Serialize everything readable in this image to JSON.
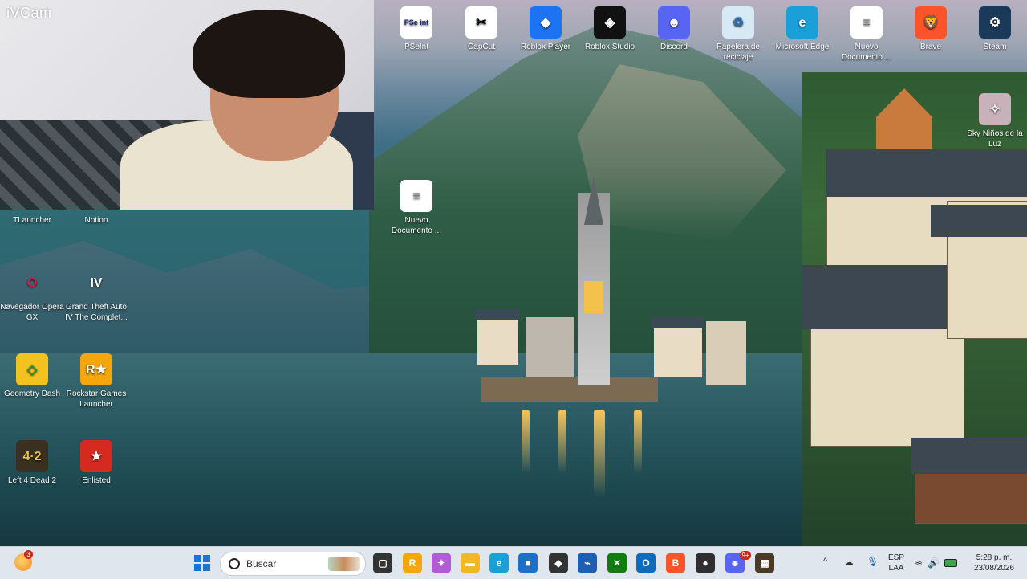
{
  "webcam": {
    "label": "iVCam"
  },
  "desktop_icons": [
    {
      "id": "pseint",
      "label": "PSeInt",
      "glyph": "PSe int",
      "color": "#ffffff",
      "fg": "#1a2a7a"
    },
    {
      "id": "capcut",
      "label": "CapCut",
      "glyph": "✂",
      "color": "#ffffff",
      "fg": "#000000"
    },
    {
      "id": "roblox-player",
      "label": "Roblox Player",
      "glyph": "◆",
      "color": "#1d73f2",
      "fg": "#ffffff"
    },
    {
      "id": "roblox-studio",
      "label": "Roblox Studio",
      "glyph": "◈",
      "color": "#111111",
      "fg": "#ffffff"
    },
    {
      "id": "discord",
      "label": "Discord",
      "glyph": "☻",
      "color": "#5865f2",
      "fg": "#ffffff"
    },
    {
      "id": "recycle-bin",
      "label": "Papelera de reciclaje",
      "glyph": "♻",
      "color": "#d7e9f5",
      "fg": "#2b6fb1"
    },
    {
      "id": "edge",
      "label": "Microsoft Edge",
      "glyph": "e",
      "color": "#1a9fd6",
      "fg": "#ffffff"
    },
    {
      "id": "nuevo-doc-top",
      "label": "Nuevo Documento ...",
      "glyph": "≡",
      "color": "#ffffff",
      "fg": "#7a7a7a"
    },
    {
      "id": "brave",
      "label": "Brave",
      "glyph": "🦁",
      "color": "#fb542b",
      "fg": "#ffffff"
    },
    {
      "id": "steam",
      "label": "Steam",
      "glyph": "⚙",
      "color": "#1b3a5a",
      "fg": "#ffffff"
    },
    {
      "id": "sky",
      "label": "Sky Niños de la Luz",
      "glyph": "✧",
      "color": "#c9b1b9",
      "fg": "#ffffff"
    },
    {
      "id": "tlauncher",
      "label": "TLauncher",
      "glyph": "",
      "color": "transparent",
      "fg": "#ffffff"
    },
    {
      "id": "notion",
      "label": "Notion",
      "glyph": "",
      "color": "transparent",
      "fg": "#ffffff"
    },
    {
      "id": "nuevo-doc-mid",
      "label": "Nuevo Documento ...",
      "glyph": "≡",
      "color": "#ffffff",
      "fg": "#7a7a7a"
    },
    {
      "id": "opera-gx",
      "label": "Navegador Opera GX",
      "glyph": "O",
      "color": "transparent",
      "fg": "#e0164f"
    },
    {
      "id": "gta4",
      "label": "Grand Theft Auto IV The Complet...",
      "glyph": "IV",
      "color": "transparent",
      "fg": "#ffffff"
    },
    {
      "id": "geometry-dash",
      "label": "Geometry Dash",
      "glyph": "◇",
      "color": "#f4c21f",
      "fg": "#1e9c3a"
    },
    {
      "id": "rockstar",
      "label": "Rockstar Games Launcher",
      "glyph": "R★",
      "color": "#f4a60c",
      "fg": "#ffffff"
    },
    {
      "id": "l4d2",
      "label": "Left 4 Dead 2",
      "glyph": "4·2",
      "color": "#3a3020",
      "fg": "#e8c24a"
    },
    {
      "id": "enlisted",
      "label": "Enlisted",
      "glyph": "★",
      "color": "#d42a1f",
      "fg": "#ffffff"
    }
  ],
  "taskbar": {
    "notification_badge": "3",
    "search_placeholder": "Buscar",
    "pinned": [
      {
        "id": "start",
        "glyph": "⊞",
        "color": "#1a73d9"
      },
      {
        "id": "task-view",
        "glyph": "▢",
        "color": "#333333"
      },
      {
        "id": "rockstar",
        "glyph": "R",
        "color": "#f4a60c"
      },
      {
        "id": "copilot",
        "glyph": "✦",
        "color": "#b15bd6"
      },
      {
        "id": "file-explorer",
        "glyph": "▬",
        "color": "#f2b824"
      },
      {
        "id": "edge",
        "glyph": "e",
        "color": "#1a9fd6"
      },
      {
        "id": "store",
        "glyph": "■",
        "color": "#1d70c9"
      },
      {
        "id": "unity",
        "glyph": "◆",
        "color": "#333333"
      },
      {
        "id": "visual-studio",
        "glyph": "⌁",
        "color": "#1e5fb4"
      },
      {
        "id": "xbox",
        "glyph": "✕",
        "color": "#107c10"
      },
      {
        "id": "outlook",
        "glyph": "O",
        "color": "#0f6cbd"
      },
      {
        "id": "brave",
        "glyph": "B",
        "color": "#fb542b"
      },
      {
        "id": "obs",
        "glyph": "●",
        "color": "#302e31"
      },
      {
        "id": "discord",
        "glyph": "☻",
        "color": "#5865f2"
      },
      {
        "id": "minecraft",
        "glyph": "▦",
        "color": "#4b3a24"
      }
    ],
    "discord_badge": "9+",
    "language": {
      "line1": "ESP",
      "line2": "LAA"
    },
    "clock": {
      "time": "5:28 p. m.",
      "date": "23/08/2026"
    }
  }
}
